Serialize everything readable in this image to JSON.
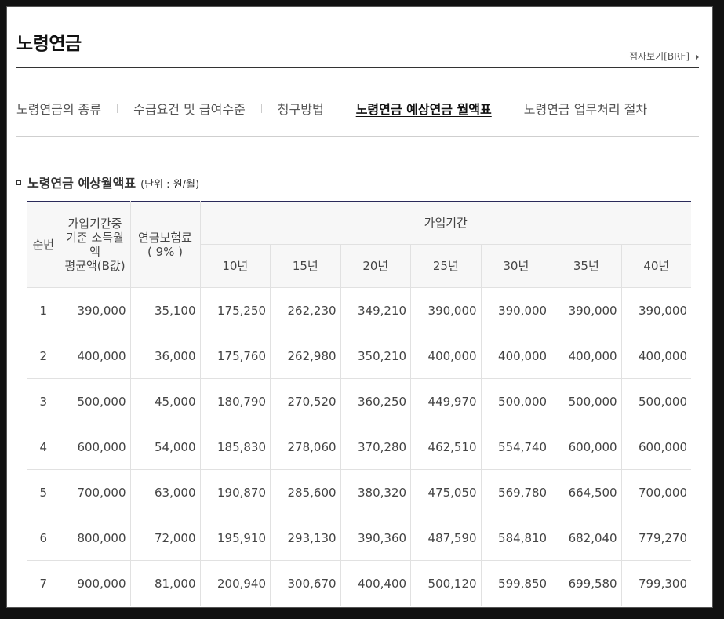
{
  "page": {
    "title": "노령연금",
    "view_link": "점자보기[BRF]"
  },
  "tabs": [
    {
      "label": "노령연금의 종류"
    },
    {
      "label": "수급요건 및 급여수준"
    },
    {
      "label": "청구방법"
    },
    {
      "label": "노령연금 예상연금 월액표"
    },
    {
      "label": "노령연금 업무처리 절차"
    }
  ],
  "section": {
    "heading": "노령연금 예상월액표",
    "unit": "(단위 : 원/월)"
  },
  "table": {
    "headers": {
      "num": "순번",
      "income_line1": "가입기간중",
      "income_line2": "기준 소득월",
      "income_line3": "액",
      "income_line4": "평균액(B값)",
      "premium_line1": "연금보험료",
      "premium_line2": "( 9% )",
      "period": "가입기간",
      "years": [
        "10년",
        "15년",
        "20년",
        "25년",
        "30년",
        "35년",
        "40년"
      ]
    },
    "rows": [
      [
        "1",
        "390,000",
        "35,100",
        "175,250",
        "262,230",
        "349,210",
        "390,000",
        "390,000",
        "390,000",
        "390,000"
      ],
      [
        "2",
        "400,000",
        "36,000",
        "175,760",
        "262,980",
        "350,210",
        "400,000",
        "400,000",
        "400,000",
        "400,000"
      ],
      [
        "3",
        "500,000",
        "45,000",
        "180,790",
        "270,520",
        "360,250",
        "449,970",
        "500,000",
        "500,000",
        "500,000"
      ],
      [
        "4",
        "600,000",
        "54,000",
        "185,830",
        "278,060",
        "370,280",
        "462,510",
        "554,740",
        "600,000",
        "600,000"
      ],
      [
        "5",
        "700,000",
        "63,000",
        "190,870",
        "285,600",
        "380,320",
        "475,050",
        "569,780",
        "664,500",
        "700,000"
      ],
      [
        "6",
        "800,000",
        "72,000",
        "195,910",
        "293,130",
        "390,360",
        "487,590",
        "584,810",
        "682,040",
        "779,270"
      ],
      [
        "7",
        "900,000",
        "81,000",
        "200,940",
        "300,670",
        "400,400",
        "500,120",
        "599,850",
        "699,580",
        "799,300"
      ]
    ]
  }
}
